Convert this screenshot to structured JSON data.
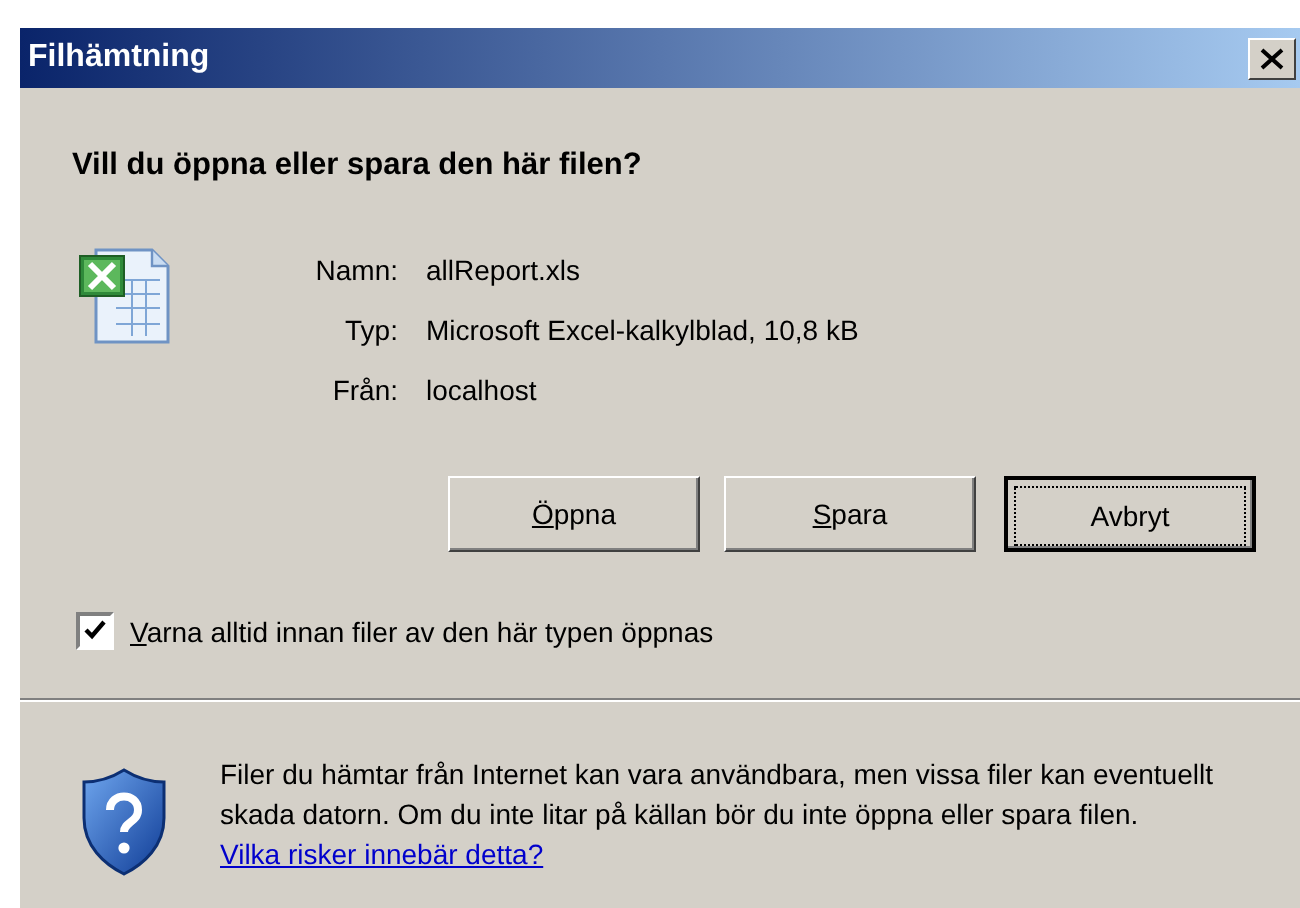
{
  "window": {
    "title": "Filhämtning"
  },
  "question": "Vill du öppna eller spara den här filen?",
  "file_info": [
    {
      "label": "Namn:",
      "value": "allReport.xls"
    },
    {
      "label": "Typ:",
      "value": "Microsoft Excel-kalkylblad, 10,8 kB"
    },
    {
      "label": "Från:",
      "value": "localhost"
    }
  ],
  "buttons": [
    {
      "label": "Öppna",
      "mnemonic": true,
      "default": false
    },
    {
      "label": "Spara",
      "mnemonic": true,
      "default": false
    },
    {
      "label": "Avbryt",
      "mnemonic": false,
      "default": true
    }
  ],
  "warn_checkbox": {
    "label": "Varna alltid innan filer av den här typen öppnas",
    "checked": true
  },
  "security_note": {
    "text": "Filer du hämtar från Internet kan vara användbara, men vissa filer kan eventuellt skada datorn. Om du inte litar på källan bör du inte öppna eller spara filen.",
    "link": "Vilka risker innebär detta?"
  }
}
